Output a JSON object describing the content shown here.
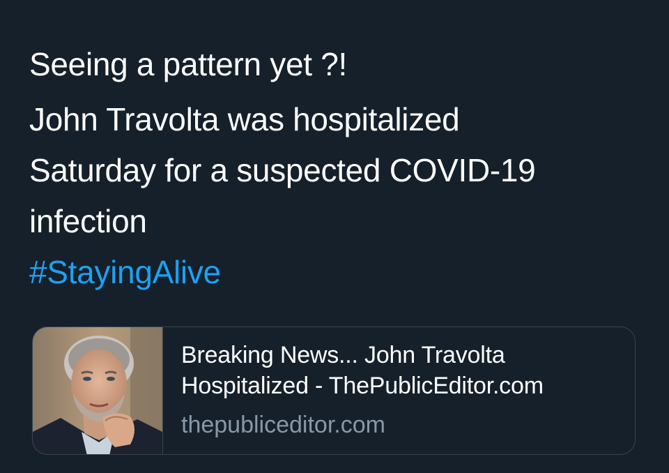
{
  "tweet": {
    "line1": "Seeing a pattern yet ?!",
    "line2": "John Travolta was hospitalized",
    "line3": "Saturday for a suspected COVID-19",
    "line4": "infection",
    "hashtag": "#StayingAlive"
  },
  "link_card": {
    "title_line1": "Breaking News... John Travolta",
    "title_line2": "Hospitalized - ThePublicEditor.com",
    "domain": "thepubliceditor.com",
    "thumbnail": "portrait-photo"
  },
  "colors": {
    "background": "#15202b",
    "text": "#ffffff",
    "link": "#1da1f2",
    "secondary_text": "#8899a6",
    "border": "#38444d"
  }
}
